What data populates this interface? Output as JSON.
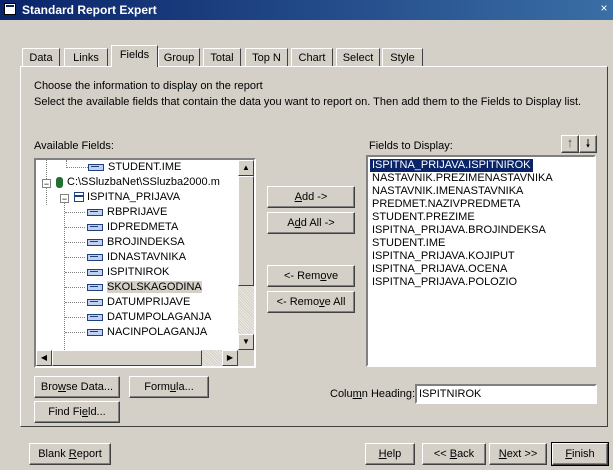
{
  "window": {
    "title": "Standard Report Expert",
    "close_glyph": "×"
  },
  "tabs": [
    {
      "label": "Data"
    },
    {
      "label": "Links"
    },
    {
      "label": "Fields",
      "active": true
    },
    {
      "label": "Group"
    },
    {
      "label": "Total"
    },
    {
      "label": "Top N"
    },
    {
      "label": "Chart"
    },
    {
      "label": "Select"
    },
    {
      "label": "Style"
    }
  ],
  "instructions": {
    "line1": "Choose the information to display on the report",
    "line2": "Select the available fields that contain the data you want to report on.  Then add them to the Fields to Display list."
  },
  "available": {
    "label": "Available Fields:",
    "tree": [
      {
        "text": "STUDENT.IME",
        "kind": "field",
        "level": 2
      },
      {
        "text": "C:\\SSluzbaNet\\SSluzba2000.m",
        "kind": "database",
        "level": 0,
        "expander": "−"
      },
      {
        "text": "ISPITNA_PRIJAVA",
        "kind": "table",
        "level": 1,
        "expander": "−"
      },
      {
        "text": "RBPRIJAVE",
        "kind": "field",
        "level": 2
      },
      {
        "text": "IDPREDMETA",
        "kind": "field",
        "level": 2
      },
      {
        "text": "BROJINDEKSA",
        "kind": "field",
        "level": 2
      },
      {
        "text": "IDNASTAVNIKA",
        "kind": "field",
        "level": 2
      },
      {
        "text": "ISPITNIROK",
        "kind": "field",
        "level": 2
      },
      {
        "text": "SKOLSKAGODINA",
        "kind": "field",
        "level": 2,
        "highlighted": true
      },
      {
        "text": "DATUMPRIJAVE",
        "kind": "field",
        "level": 2
      },
      {
        "text": "DATUMPOLAGANJA",
        "kind": "field",
        "level": 2
      },
      {
        "text": "NACINPOLAGANJA",
        "kind": "field",
        "level": 2
      }
    ]
  },
  "buttons": {
    "add": "Add ->",
    "add_all": "Add All ->",
    "remove": "<- Remove",
    "remove_all": "<- Remove All",
    "browse": "Browse Data...",
    "formula": "Formula...",
    "find_field": "Find Field...",
    "blank_report": "Blank Report",
    "help": "Help",
    "back": "<< Back",
    "next": "Next >>",
    "finish": "Finish"
  },
  "display": {
    "label": "Fields to Display:",
    "items": [
      {
        "text": "ISPITNA_PRIJAVA.ISPITNIROK",
        "selected": true
      },
      {
        "text": "NASTAVNIK.PREZIMENASTAVNIKA"
      },
      {
        "text": "NASTAVNIK.IMENASTAVNIKA"
      },
      {
        "text": "PREDMET.NAZIVPREDMETA"
      },
      {
        "text": "STUDENT.PREZIME"
      },
      {
        "text": "ISPITNA_PRIJAVA.BROJINDEKSA"
      },
      {
        "text": "STUDENT.IME"
      },
      {
        "text": "ISPITNA_PRIJAVA.KOJIPUT"
      },
      {
        "text": "ISPITNA_PRIJAVA.OCENA"
      },
      {
        "text": "ISPITNA_PRIJAVA.POLOZIO"
      }
    ]
  },
  "column_heading": {
    "label": "Column Heading:",
    "value": "ISPITNIROK"
  },
  "colors": {
    "title_start": "#0a246a",
    "title_end": "#3a6ea5",
    "selection": "#0a246a",
    "face": "#d4d0c8"
  }
}
